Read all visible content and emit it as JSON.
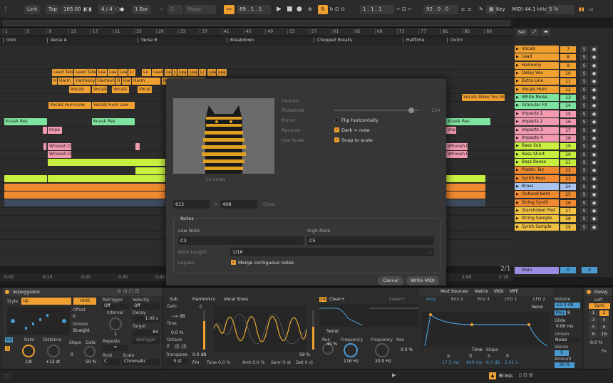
{
  "transport": {
    "link": "Link",
    "tap": "Tap",
    "tempo": "165.00",
    "sig": "4 / 4",
    "quant": "1 Bar",
    "key_root": "C",
    "key_scale": "Major",
    "position": "89 .  1 .  1",
    "loop_start": "1 .  1 .  1",
    "loop_len": "92 .  0 .  0",
    "key": "Key",
    "midi": "MIDI",
    "sample_rate": "44.1 kHz",
    "cpu": "5 %"
  },
  "ruler": {
    "bars": [
      "1",
      "5",
      "9",
      "13",
      "17",
      "21",
      "25",
      "29",
      "33",
      "37",
      "41",
      "45",
      "49",
      "53",
      "57",
      "61",
      "65",
      "69",
      "73",
      "77",
      "81",
      "85",
      "89"
    ],
    "times": [
      "0:00",
      "0:10",
      "0:20",
      "0:30",
      "0:40",
      "2:00",
      "2:10"
    ],
    "pos_display": "2/1"
  },
  "locators": [
    "Intro",
    "Verse A",
    "Verse B",
    "Breakdown",
    "Chopped Breaks",
    "Halftime",
    "Outro"
  ],
  "clips": {
    "lead_takes": [
      "Lead Take",
      "Lead Take",
      "Lea",
      "Lea",
      "Lead",
      "Li",
      "Le",
      "Lead",
      "Lea",
      "Li",
      "Lead",
      "Lea",
      "Li",
      "Lea",
      "Lea"
    ],
    "harmony": [
      "H",
      "Harm",
      "Harmony",
      "Harmon",
      "H",
      "Harm",
      "Harm",
      "Harm",
      "Harm"
    ],
    "vocals": [
      "Vocals",
      "Vocals",
      "Vocals",
      "Vocal",
      "Vocals"
    ],
    "vocals_hum_1": "Vocals Hum Low",
    "vocals_hum_2": "Vocals Hum Low",
    "vocals_make": "Vocals Make You Mi",
    "knask_1": "Knask Res",
    "knask_2": "Knask Res",
    "knask_3": "Knask Res",
    "impa_1": "Impa",
    "impa_2": "Impa",
    "whoosh_1": "Whoosh D",
    "whoosh_2": "Whoosh D",
    "whoosh_3": "Whoosh D",
    "whoosh_4": "Whoosh D"
  },
  "tracks": [
    {
      "name": "Vocals",
      "num": "7",
      "color": "#f0a030"
    },
    {
      "name": "Lead",
      "num": "8",
      "color": "#f0a030"
    },
    {
      "name": "Harmony",
      "num": "9",
      "color": "#f0a030"
    },
    {
      "name": "Delay Vox",
      "num": "10",
      "color": "#f0a030"
    },
    {
      "name": "Extra Line",
      "num": "11",
      "color": "#f0a030"
    },
    {
      "name": "Vocals Hum",
      "num": "12",
      "color": "#f0a030"
    },
    {
      "name": "White Noise",
      "num": "13",
      "color": "#7fe3a0"
    },
    {
      "name": "Granular FX",
      "num": "14",
      "color": "#7fe3a0"
    },
    {
      "name": "Impacts 1",
      "num": "15",
      "color": "#f29ab0"
    },
    {
      "name": "Impacts 2",
      "num": "16",
      "color": "#f29ab0"
    },
    {
      "name": "Impacts 3",
      "num": "17",
      "color": "#f29ab0"
    },
    {
      "name": "Impacts 4",
      "num": "18",
      "color": "#f29ab0"
    },
    {
      "name": "Bass Sub",
      "num": "19",
      "color": "#c8ef40"
    },
    {
      "name": "Bass Short",
      "num": "20",
      "color": "#c8ef40"
    },
    {
      "name": "Bass Reese",
      "num": "21",
      "color": "#c8ef40"
    },
    {
      "name": "Plastic Toy",
      "num": "22",
      "color": "#f08a30"
    },
    {
      "name": "Synth Keys",
      "num": "23",
      "color": "#f08a30"
    },
    {
      "name": "Brass",
      "num": "24",
      "color": "#a8c4ee"
    },
    {
      "name": "Outland Bells",
      "num": "25",
      "color": "#f08a30"
    },
    {
      "name": "String Synth",
      "num": "26",
      "color": "#f08a30"
    },
    {
      "name": "Starshower Pad",
      "num": "27",
      "color": "#f0c040"
    },
    {
      "name": "String Sample",
      "num": "28",
      "color": "#f0c040"
    },
    {
      "name": "Synth Sample",
      "num": "29",
      "color": "#f0c040"
    }
  ],
  "main_track": {
    "name": "Main",
    "num": "0",
    "num2": "0"
  },
  "set_label": "Set",
  "dialog": {
    "image_label": "IMAGE",
    "threshold": "Threshold",
    "threshold_val": "234",
    "mirror": "Mirror",
    "flip": "Flip horizontally",
    "reverse": "Reverse",
    "dark_note": "Dark = note",
    "use_scale": "Use Scale",
    "snap": "Snap to scale",
    "notes_count": "13 notes",
    "width": "612",
    "height": "408",
    "x": "×",
    "clear": "Clear",
    "notes_title": "Notes",
    "low_note_label": "Low Note",
    "high_note_label": "High Note",
    "low_note": "C3",
    "high_note": "C5",
    "note_length_label": "Note Length",
    "note_length": "1/16",
    "legato_label": "Legato",
    "merge": "Merge contiguous notes",
    "cancel": "Cancel",
    "write": "Write MIDI"
  },
  "arp": {
    "title": "Arpeggiator",
    "style_label": "Style",
    "style": "Up",
    "hold": "Hold",
    "offset_label": "Offset",
    "offset": "0",
    "groove_label": "Groove",
    "groove": "Straight",
    "rate_label": "Rate",
    "rate": "1/8",
    "distance_label": "Distance",
    "distance": "+12 st",
    "steps_label": "Steps",
    "steps": "0",
    "gate_label": "Gate",
    "gate": "50 %",
    "retrigger_label": "Retrigger",
    "retrigger": "Off",
    "interval_label": "Interval",
    "interval": "1",
    "repeats_label": "Repeats",
    "repeats": "∞",
    "root_label": "Root",
    "root": "C",
    "velocity_label": "Velocity",
    "velocity": "Off",
    "decay_label": "Decay",
    "decay": "1.00 s",
    "target_label": "Target",
    "target": "64",
    "retrigger_btn": "Retrigger",
    "scale_label": "Scale",
    "scale": "Chromatic",
    "ms": "ms",
    "sync": "♫"
  },
  "synth": {
    "sub": "Sub",
    "gain": "Gain",
    "gain_val": "−∞ dB",
    "tone": "Tone",
    "tone_val": "0.0 %",
    "octave": "Octave",
    "octave_val": "0",
    "octave_m2": "-2",
    "octave_m1": "-1",
    "transpose": "Transpose",
    "transpose_val": "0 st",
    "harmonics": "Harmonics",
    "vocal_sines": "Vocal Sines",
    "osc_c": "C",
    "osc_db": "0.0 dB",
    "osc_pct": "59 %",
    "fm": "Fm",
    "tune": "Tune 0.0 %",
    "amt": "Amt 0.0 %",
    "semi": "Semi 0 st",
    "det": "Det 0 ct",
    "clean1": "Clean+",
    "clean2": "Clean+",
    "serial": "Serial",
    "res_label": "Res",
    "res_val": "40 %",
    "freq_label": "Frequency",
    "freq_val": "116 Hz",
    "freq2_label": "Frequency",
    "freq2_val": "20.0 Hz",
    "res2_label": "Res",
    "res2_val": "0.0 %",
    "tabs": [
      "Mod Sources",
      "Matrix",
      "MIDI",
      "MPE"
    ],
    "env_tabs": [
      "Amp",
      "Env 2",
      "Env 3",
      "LFO 1",
      "LFO 2"
    ],
    "none": "None",
    "time": "Time",
    "slope": "Slope",
    "a_label": "A",
    "d_label": "D",
    "s_label": "S",
    "r_label": "R",
    "a_val": "17.5 ms",
    "d_val": "600 ms",
    "s_val": "-6.0 dB",
    "r_val": "2.01 s",
    "volume": "Volume",
    "volume_val": "-12.0 dB",
    "poly": "Poly",
    "poly_val": "8",
    "glide": "Glide",
    "glide_val": "0.00 ms",
    "unison": "Unison",
    "unison_val": "Noise",
    "voices": "Voices",
    "voices_val": "5",
    "amount": "Amount",
    "amount_val": "30 %"
  },
  "delay": {
    "title": "Delay",
    "left": "Left",
    "sync": "Sync",
    "grid": [
      "1",
      "2",
      "3",
      "4",
      "5",
      "6",
      "8",
      "16"
    ],
    "offset": "-0.0 %",
    "fe": "Fe"
  },
  "status": {
    "track": "Brass"
  }
}
